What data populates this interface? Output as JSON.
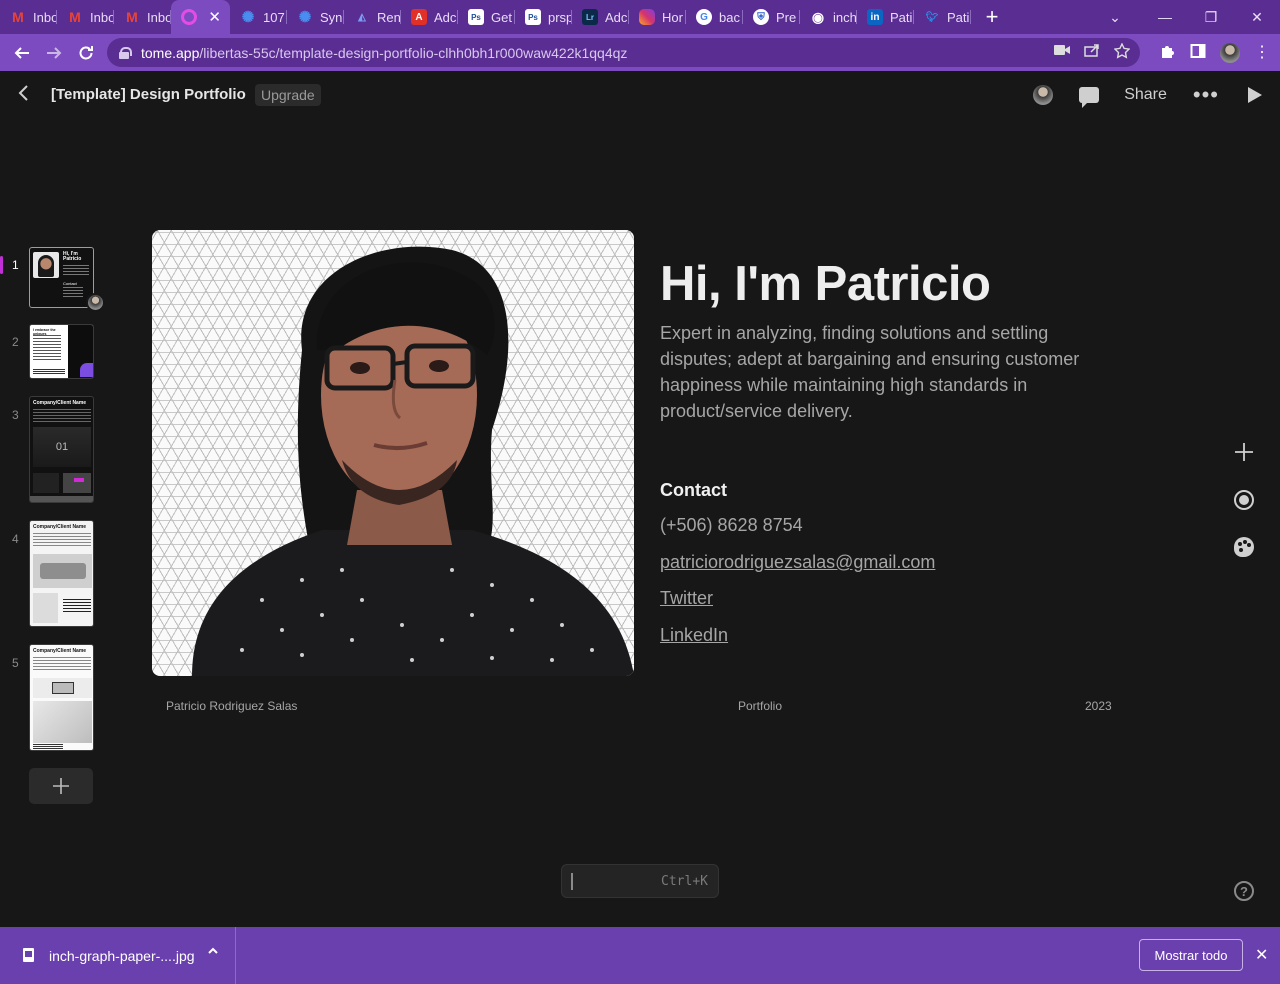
{
  "browser": {
    "tabs": [
      {
        "label": "Inbo",
        "icon": "gmail-icon",
        "color": "#ffffff"
      },
      {
        "label": "Inbo",
        "icon": "gmail-icon",
        "color": "#ffffff"
      },
      {
        "label": "Inbo",
        "icon": "gmail-icon",
        "color": "#ffffff"
      },
      {
        "label": "",
        "icon": "tome-icon",
        "color": "#e44ce8",
        "active": true
      },
      {
        "label": "107",
        "icon": "gear-icon",
        "color": "#4a8df0"
      },
      {
        "label": "Syn",
        "icon": "gear-icon",
        "color": "#4a8df0"
      },
      {
        "label": "Ren",
        "icon": "render-icon",
        "color": "#7aa0f5"
      },
      {
        "label": "Adc",
        "icon": "adobe-icon",
        "color": "#e03028"
      },
      {
        "label": "Get",
        "icon": "photoshop-icon",
        "color": "#1e4e9c"
      },
      {
        "label": "prsp",
        "icon": "photoshop-icon",
        "color": "#1e4e9c"
      },
      {
        "label": "Adc",
        "icon": "lightroom-icon",
        "color": "#0b2a4a"
      },
      {
        "label": "Hor",
        "icon": "instagram-icon",
        "color": "#d6336c"
      },
      {
        "label": "bac",
        "icon": "google-icon",
        "color": "#ffffff"
      },
      {
        "label": "Pre",
        "icon": "shield-icon",
        "color": "#2d5ecf"
      },
      {
        "label": "inch",
        "icon": "globe-icon",
        "color": "#ffffff"
      },
      {
        "label": "Pati",
        "icon": "linkedin-icon",
        "color": "#0a66c2"
      },
      {
        "label": "Pati",
        "icon": "twitter-icon",
        "color": "#1d9bf0"
      }
    ],
    "url_host": "tome.app",
    "url_path": "/libertas-55c/template-design-portfolio-clhh0bh1r000waw422k1qq4qz"
  },
  "app": {
    "title": "[Template] Design Portfolio",
    "upgrade_label": "Upgrade",
    "share_label": "Share"
  },
  "slides": [
    {
      "number": "1",
      "active": true
    },
    {
      "number": "2"
    },
    {
      "number": "3"
    },
    {
      "number": "4"
    },
    {
      "number": "5"
    }
  ],
  "thumbnail_text": {
    "t1_title": "Hi, I'm Patricio",
    "t1_contact": "Contact",
    "t2_title": "I embrace the uniques",
    "t3_title": "Company/Client Name",
    "t3_number": "01",
    "t4_title": "Company/Client Name",
    "t5_title": "Company/Client Name"
  },
  "slide": {
    "headline": "Hi, I'm Patricio",
    "bio": "Expert in analyzing, finding solutions and settling disputes; adept at bargaining and ensuring customer happiness while maintaining high standards in product/service delivery.",
    "contact_title": "Contact",
    "phone": "(+506) 8628 8754",
    "email": "patriciorodriguezsalas@gmail.com",
    "twitter": "Twitter",
    "linkedin": "LinkedIn ",
    "footer_left": "Patricio Rodriguez Salas",
    "footer_center": "Portfolio",
    "footer_right": "2023"
  },
  "command_bar": {
    "shortcut": "Ctrl+K"
  },
  "download_bar": {
    "file_name": "inch-graph-paper-....jpg",
    "show_all_label": "Mostrar todo"
  }
}
